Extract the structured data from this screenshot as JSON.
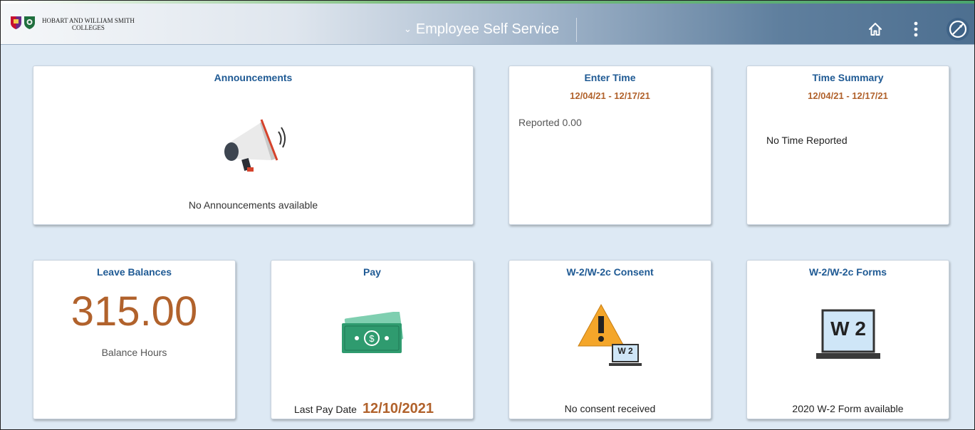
{
  "header": {
    "logo_line1": "HOBART AND WILLIAM SMITH",
    "logo_line2": "COLLEGES",
    "title": "Employee Self Service",
    "chevron": "⌄"
  },
  "tiles": {
    "announcements": {
      "title": "Announcements",
      "text": "No Announcements available"
    },
    "enter_time": {
      "title": "Enter Time",
      "dates": "12/04/21 - 12/17/21",
      "text": "Reported 0.00"
    },
    "time_summary": {
      "title": "Time Summary",
      "dates": "12/04/21 - 12/17/21",
      "text": "No Time Reported"
    },
    "leave_balances": {
      "title": "Leave Balances",
      "value": "315.00",
      "text": "Balance Hours"
    },
    "pay": {
      "title": "Pay",
      "label": "Last Pay Date",
      "date": "12/10/2021"
    },
    "w2_consent": {
      "title": "W-2/W-2c Consent",
      "icon_label": "W 2",
      "text": "No consent received"
    },
    "w2_forms": {
      "title": "W-2/W-2c Forms",
      "icon_label": "W 2",
      "text": "2020 W-2 Form available"
    }
  },
  "icons": {
    "home": "home-icon",
    "actions": "actions-menu-icon",
    "navbar": "navbar-icon",
    "announcements": "megaphone-icon",
    "pay": "money-icon",
    "w2_consent": "warning-icon",
    "w2_forms": "w2-monitor-icon"
  },
  "colors": {
    "tile_title": "#1f5a94",
    "accent_orange": "#b1622c",
    "background": "#dde9f4"
  }
}
